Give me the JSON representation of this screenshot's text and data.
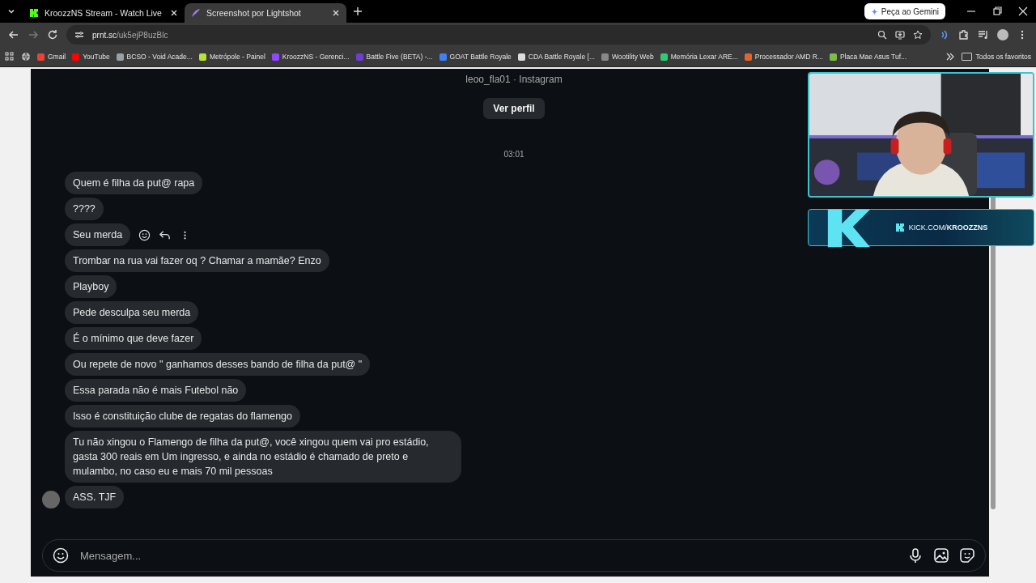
{
  "tabs": [
    {
      "title": "KroozzNS Stream - Watch Live",
      "selected": false
    },
    {
      "title": "Screenshot por Lightshot",
      "selected": true
    }
  ],
  "gemini_button": "Peça ao Gemini",
  "address": {
    "host": "prnt.sc",
    "path": "/uk5ejP8uzBlc"
  },
  "bookmarks": [
    "Gmail",
    "YouTube",
    "BCSO - Void Acade...",
    "Metrópole - Painel",
    "KroozzNS - Gerenci...",
    "Battle Five (BETA) -...",
    "GOAT Battle Royale",
    "CDA Battle Royale [...",
    "Wootility Web",
    "Memória Lexar ARE...",
    "Processador AMD R...",
    "Placa Mae Asus Tuf..."
  ],
  "all_bookmarks": "Todos os favoritos",
  "chat": {
    "header": "leoo_fla01 · Instagram",
    "profile_button": "Ver perfil",
    "time": "03:01",
    "messages": [
      {
        "text": "Quem é filha da put@ rapa",
        "hovered": false,
        "avatar": false
      },
      {
        "text": "????",
        "hovered": false,
        "avatar": false
      },
      {
        "text": "Seu merda",
        "hovered": true,
        "avatar": false
      },
      {
        "text": "Trombar na rua vai fazer oq ? Chamar a mamãe? Enzo",
        "hovered": false,
        "avatar": false
      },
      {
        "text": "Playboy",
        "hovered": false,
        "avatar": false
      },
      {
        "text": "Pede desculpa seu merda",
        "hovered": false,
        "avatar": false
      },
      {
        "text": "É o mínimo que deve fazer",
        "hovered": false,
        "avatar": false
      },
      {
        "text": "Ou repete de novo \" ganhamos desses bando de filha da put@ \"",
        "hovered": false,
        "avatar": false
      },
      {
        "text": "Essa parada não é mais Futebol não",
        "hovered": false,
        "avatar": false
      },
      {
        "text": "Isso é constituição clube de regatas do flamengo",
        "hovered": false,
        "avatar": false
      },
      {
        "text": "Tu não xingou o Flamengo de filha da put@, você xingou quem vai pro estádio, gasta 300 reais em Um ingresso, e ainda no estádio é chamado de preto e mulambo, no caso eu e mais 70 mil pessoas",
        "hovered": false,
        "avatar": false
      },
      {
        "text": "ASS. TJF",
        "hovered": false,
        "avatar": true
      }
    ],
    "input": {
      "placeholder": "Mensagem..."
    }
  },
  "stream_overlay": {
    "url": "KICK.COM/**KROOZZNS**"
  }
}
